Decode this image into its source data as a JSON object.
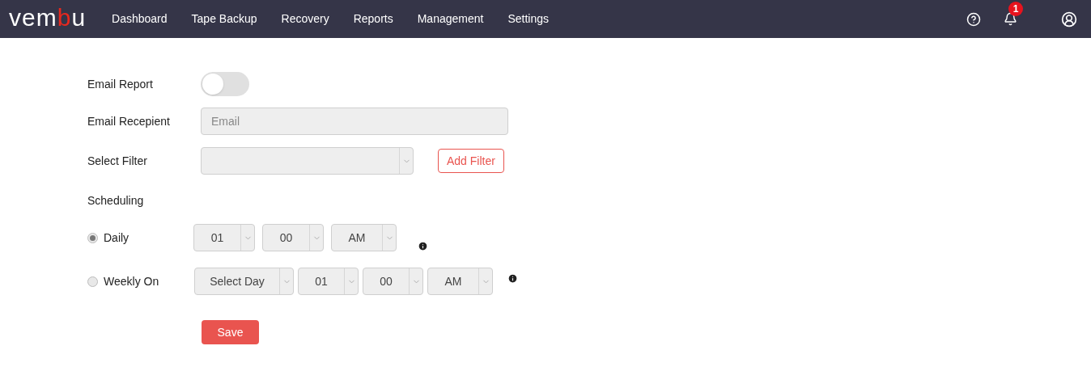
{
  "navbar": {
    "logo": [
      {
        "text": "vem",
        "color": "#ffffff"
      },
      {
        "text": "b",
        "color": "#e8281e"
      },
      {
        "text": "u",
        "color": "#ffffff"
      }
    ],
    "items": [
      "Dashboard",
      "Tape Backup",
      "Recovery",
      "Reports",
      "Management",
      "Settings"
    ],
    "notification_count": "1"
  },
  "form": {
    "email_report": {
      "label": "Email Report",
      "on": false
    },
    "email_recipient": {
      "label": "Email Recepient",
      "placeholder": "Email"
    },
    "filter": {
      "label": "Select Filter",
      "button": "Add Filter"
    },
    "scheduling_label": "Scheduling",
    "schedules": [
      {
        "label": "Daily",
        "selected": true,
        "dropdowns": [
          "01",
          "00",
          "AM"
        ]
      },
      {
        "label": "Weekly On",
        "selected": false,
        "dropdowns": [
          "Select Day",
          "01",
          "00",
          "AM"
        ]
      }
    ],
    "save": "Save"
  }
}
